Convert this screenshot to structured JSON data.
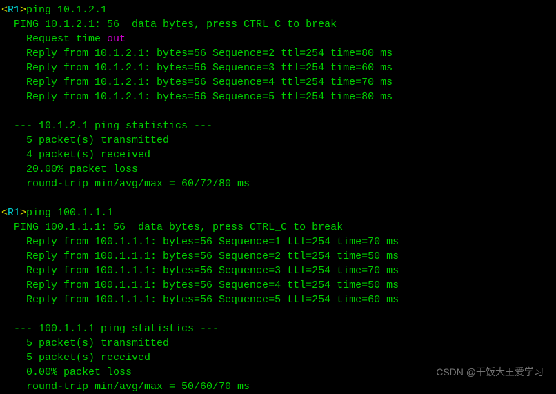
{
  "ping1": {
    "prompt_open": "<",
    "host": "R1",
    "prompt_close": ">",
    "cmd": "ping 10.1.2.1",
    "header": "  PING 10.1.2.1: 56  data bytes, press CTRL_C to break",
    "timeout_prefix": "    Request time ",
    "timeout_word": "out",
    "replies": [
      "    Reply from 10.1.2.1: bytes=56 Sequence=2 ttl=254 time=80 ms",
      "    Reply from 10.1.2.1: bytes=56 Sequence=3 ttl=254 time=60 ms",
      "    Reply from 10.1.2.1: bytes=56 Sequence=4 ttl=254 time=70 ms",
      "    Reply from 10.1.2.1: bytes=56 Sequence=5 ttl=254 time=80 ms"
    ],
    "stats_header": "  --- 10.1.2.1 ping statistics ---",
    "stats_tx": "    5 packet(s) transmitted",
    "stats_rx": "    4 packet(s) received",
    "stats_loss": "    20.00% packet loss",
    "stats_rt": "    round-trip min/avg/max = 60/72/80 ms"
  },
  "ping2": {
    "prompt_open": "<",
    "host": "R1",
    "prompt_close": ">",
    "cmd": "ping 100.1.1.1",
    "header": "  PING 100.1.1.1: 56  data bytes, press CTRL_C to break",
    "replies": [
      "    Reply from 100.1.1.1: bytes=56 Sequence=1 ttl=254 time=70 ms",
      "    Reply from 100.1.1.1: bytes=56 Sequence=2 ttl=254 time=50 ms",
      "    Reply from 100.1.1.1: bytes=56 Sequence=3 ttl=254 time=70 ms",
      "    Reply from 100.1.1.1: bytes=56 Sequence=4 ttl=254 time=50 ms",
      "    Reply from 100.1.1.1: bytes=56 Sequence=5 ttl=254 time=60 ms"
    ],
    "stats_header": "  --- 100.1.1.1 ping statistics ---",
    "stats_tx": "    5 packet(s) transmitted",
    "stats_rx": "    5 packet(s) received",
    "stats_loss": "    0.00% packet loss",
    "stats_rt": "    round-trip min/avg/max = 50/60/70 ms"
  },
  "watermark": "CSDN @干饭大王爱学习"
}
